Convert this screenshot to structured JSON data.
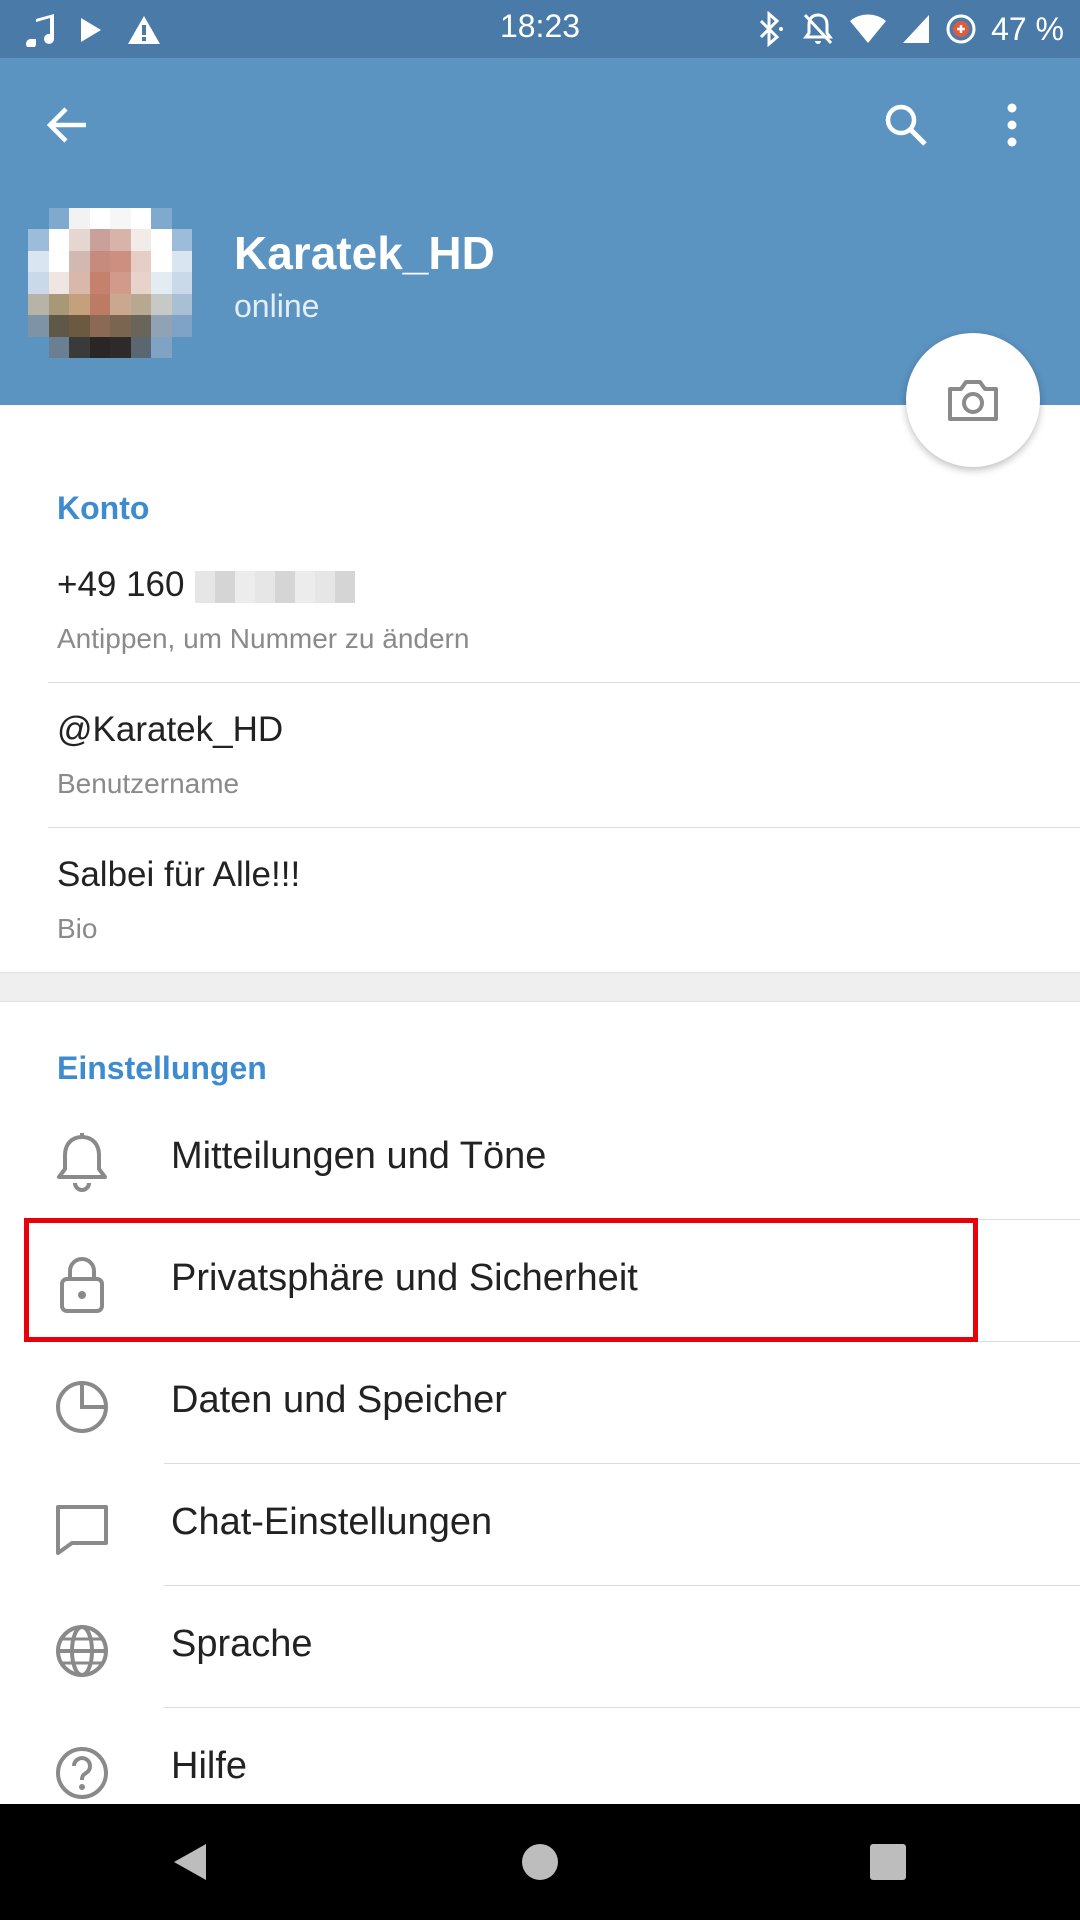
{
  "status_bar": {
    "time": "18:23",
    "battery": "47 %",
    "left_icons": [
      "music-note-icon",
      "play-icon",
      "warning-icon"
    ],
    "right_icons": [
      "bluetooth-icon",
      "mute-icon",
      "wifi-icon",
      "signal-icon",
      "battery-saver-icon"
    ]
  },
  "header": {
    "name": "Karatek_HD",
    "status": "online",
    "back_icon": "arrow-left-icon",
    "search_icon": "search-icon",
    "menu_icon": "more-vert-icon"
  },
  "account": {
    "title": "Konto",
    "phone": "+49 160",
    "phone_hint": "Antippen, um Nummer zu ändern",
    "username": "@Karatek_HD",
    "username_label": "Benutzername",
    "bio": "Salbei für Alle!!!",
    "bio_label": "Bio"
  },
  "settings": {
    "title": "Einstellungen",
    "items": [
      {
        "label": "Mitteilungen und Töne",
        "icon": "bell-icon"
      },
      {
        "label": "Privatsphäre und Sicherheit",
        "icon": "lock-icon"
      },
      {
        "label": "Daten und Speicher",
        "icon": "pie-chart-icon"
      },
      {
        "label": "Chat-Einstellungen",
        "icon": "chat-bubble-icon"
      },
      {
        "label": "Sprache",
        "icon": "globe-icon"
      },
      {
        "label": "Hilfe",
        "icon": "help-circle-icon"
      }
    ]
  },
  "colors": {
    "header": "#5b93c1",
    "status_bar": "#4a7ba8",
    "accent": "#3e8ccf",
    "highlight": "#e8000b"
  }
}
